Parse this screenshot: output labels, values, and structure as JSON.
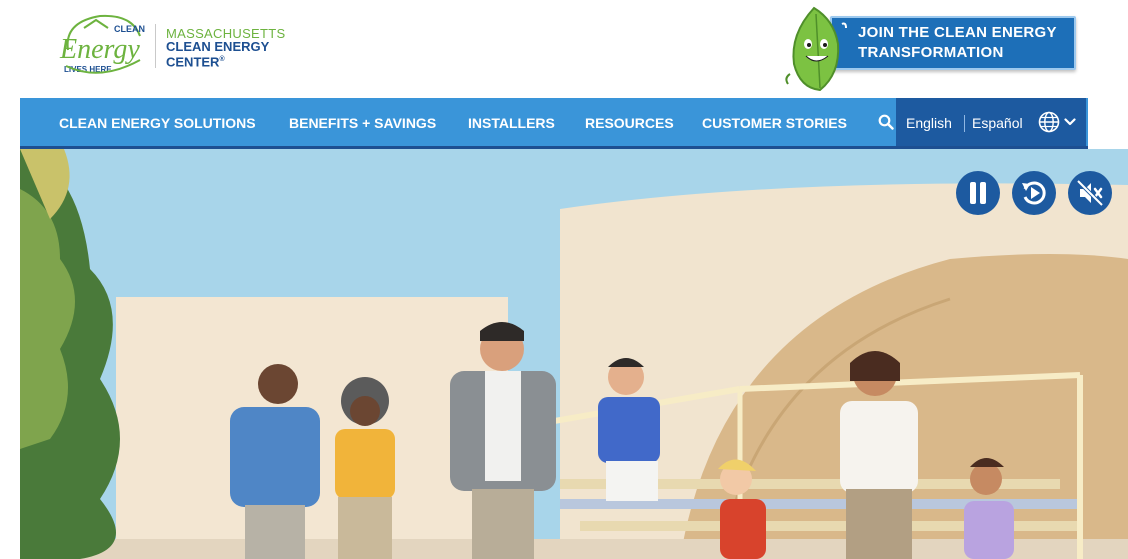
{
  "logo": {
    "mark_top": "CLEAN",
    "mark_word": "Energy",
    "mark_bottom": "LIVES HERE",
    "line1": "MASSACHUSETTS",
    "line2": "CLEAN ENERGY",
    "line3": "CENTER",
    "reg": "®"
  },
  "cta": {
    "line1": "JOIN THE CLEAN ENERGY",
    "line2": "TRANSFORMATION"
  },
  "nav": {
    "items": [
      {
        "label": "CLEAN ENERGY SOLUTIONS"
      },
      {
        "label": "BENEFITS + SAVINGS"
      },
      {
        "label": "INSTALLERS"
      },
      {
        "label": "RESOURCES"
      },
      {
        "label": "CUSTOMER STORIES"
      }
    ],
    "search_icon": "search-icon",
    "language": {
      "english": "English",
      "spanish": "Español",
      "globe_icon": "globe-icon",
      "chevron_icon": "chevron-down-icon"
    }
  },
  "hero": {
    "controls": [
      {
        "name": "pause",
        "icon": "pause-icon"
      },
      {
        "name": "replay",
        "icon": "replay-icon"
      },
      {
        "name": "mute",
        "icon": "mute-icon"
      }
    ]
  },
  "colors": {
    "nav_blue": "#3a95d9",
    "nav_dark": "#1d5aa0",
    "brand_green": "#6db33f",
    "brand_navy": "#1d4f91",
    "sky": "#a8d5ea"
  }
}
